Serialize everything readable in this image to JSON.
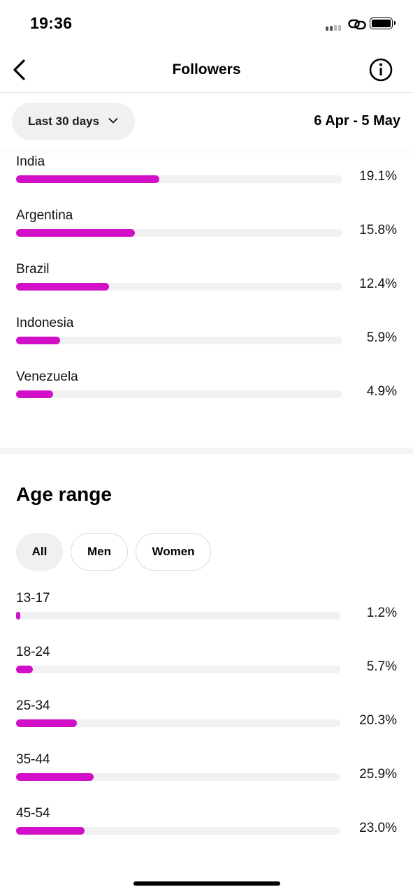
{
  "status_bar": {
    "time": "19:36",
    "signal_icon": "signal-icon",
    "link_icon": "link-icon",
    "battery_icon": "battery-icon"
  },
  "nav": {
    "title": "Followers",
    "back_icon": "chevron-left-icon",
    "info_icon": "info-icon"
  },
  "filter": {
    "period_label": "Last 30 days",
    "period_icon": "chevron-down-icon",
    "date_range": "6 Apr - 5 May"
  },
  "countries": [
    {
      "label": "India",
      "value": "19.1%",
      "fraction": 0.191
    },
    {
      "label": "Argentina",
      "value": "15.8%",
      "fraction": 0.158
    },
    {
      "label": "Brazil",
      "value": "12.4%",
      "fraction": 0.124
    },
    {
      "label": "Indonesia",
      "value": "5.9%",
      "fraction": 0.059
    },
    {
      "label": "Venezuela",
      "value": "4.9%",
      "fraction": 0.049
    }
  ],
  "age_section": {
    "title": "Age range",
    "segments": [
      {
        "label": "All",
        "active": true
      },
      {
        "label": "Men",
        "active": false
      },
      {
        "label": "Women",
        "active": false
      }
    ],
    "ranges": [
      {
        "label": "13-17",
        "value": "1.2%",
        "fraction": 0.012
      },
      {
        "label": "18-24",
        "value": "5.7%",
        "fraction": 0.057
      },
      {
        "label": "25-34",
        "value": "20.3%",
        "fraction": 0.203
      },
      {
        "label": "35-44",
        "value": "25.9%",
        "fraction": 0.259
      },
      {
        "label": "45-54",
        "value": "23.0%",
        "fraction": 0.23
      }
    ]
  },
  "colors": {
    "accent_bar": "#d10fc7",
    "track": "#f1f1f3",
    "pill_bg": "#eff0f2"
  }
}
